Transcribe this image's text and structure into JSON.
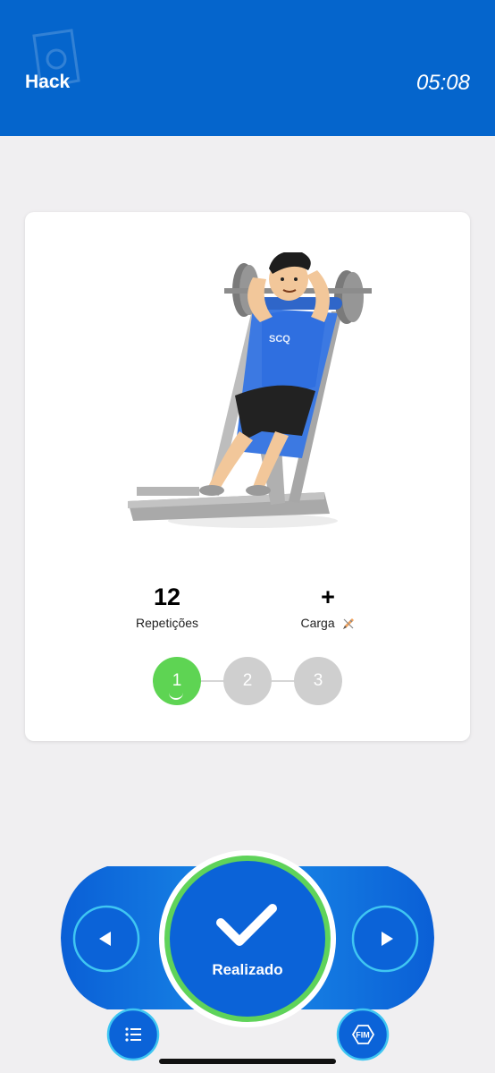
{
  "header": {
    "title": "Hack",
    "timer": "05:08"
  },
  "exercise": {
    "image_icon": "hack-squat-illustration",
    "shirt_text": "SCQ",
    "reps_value": "12",
    "reps_label": "Repetições",
    "load_value": "+",
    "load_label": "Carga",
    "load_icon": "pencil-icon"
  },
  "sets": [
    {
      "label": "1",
      "state": "active"
    },
    {
      "label": "2",
      "state": "inactive"
    },
    {
      "label": "3",
      "state": "inactive"
    }
  ],
  "controls": {
    "done_label": "Realizado",
    "prev_icon": "triangle-left-icon",
    "next_icon": "triangle-right-icon",
    "list_icon": "list-icon",
    "end_label": "FIM"
  },
  "colors": {
    "primary": "#0565cc",
    "accent_green": "#5ed453",
    "inactive_gray": "#cfcfcf",
    "background": "#f0eff1"
  }
}
